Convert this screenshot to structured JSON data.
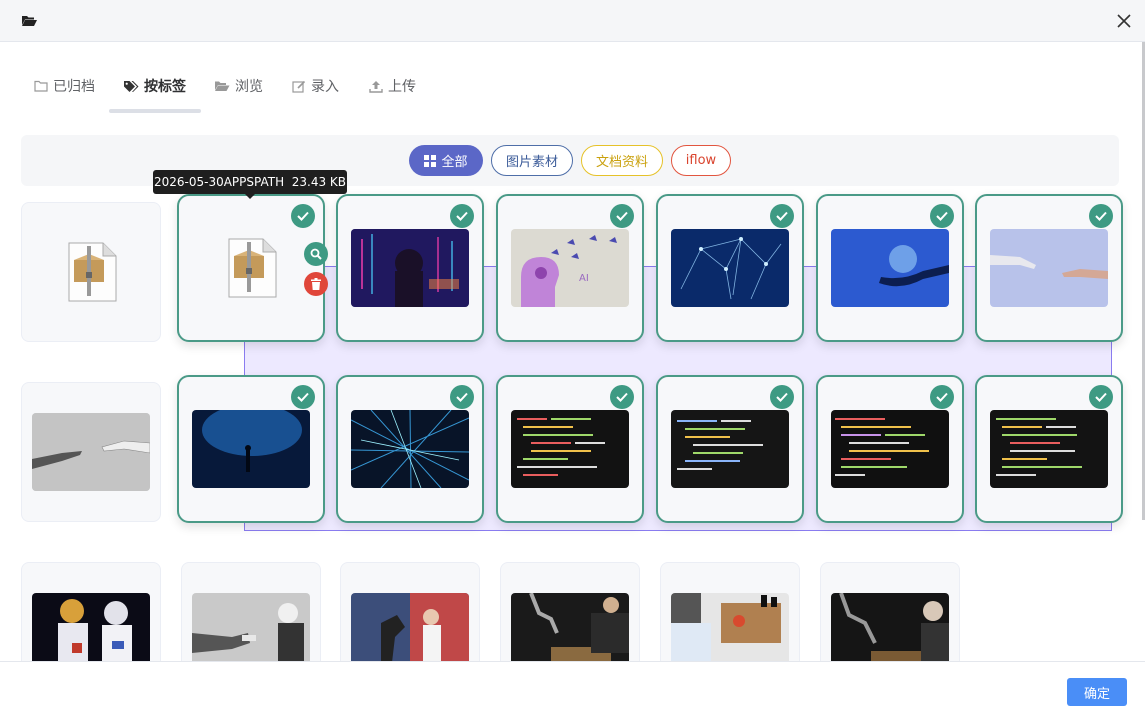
{
  "tabs": [
    {
      "label": "已归档",
      "icon": "folder-outline-icon"
    },
    {
      "label": "按标签",
      "icon": "tags-icon"
    },
    {
      "label": "浏览",
      "icon": "folder-open-icon"
    },
    {
      "label": "录入",
      "icon": "edit-icon"
    },
    {
      "label": "上传",
      "icon": "upload-icon"
    }
  ],
  "active_tab": "按标签",
  "filters": [
    {
      "label": "全部",
      "active": true,
      "color": "#5b67c7"
    },
    {
      "label": "图片素材",
      "color": "#3b5b99"
    },
    {
      "label": "文档资料",
      "color": "#caa10d"
    },
    {
      "label": "iflow",
      "color": "#d9442e"
    }
  ],
  "tooltip": {
    "text": "2026-05-30APPSPATH  23.43 KB"
  },
  "footer": {
    "confirm_label": "确定"
  },
  "colors": {
    "selected_border": "#4a9a87",
    "check": "#3e9a83",
    "delete": "#e0463a",
    "primary": "#4a8ef7"
  },
  "files": [
    {
      "kind": "zip",
      "selected": false,
      "desc": "zip archive"
    },
    {
      "kind": "zip",
      "selected": true,
      "desc": "zip archive (hovered)"
    },
    {
      "kind": "image",
      "selected": true,
      "desc": "woman with digital data overlay"
    },
    {
      "kind": "image",
      "selected": true,
      "desc": "AI head with butterflies"
    },
    {
      "kind": "image",
      "selected": true,
      "desc": "blue neural network figure"
    },
    {
      "kind": "image",
      "selected": true,
      "desc": "hand holding blue sphere"
    },
    {
      "kind": "image",
      "selected": true,
      "desc": "robot hand reaching human hand"
    },
    {
      "kind": "image",
      "selected": false,
      "desc": "grayscale hands reaching"
    },
    {
      "kind": "image",
      "selected": true,
      "desc": "person under blue light"
    },
    {
      "kind": "image",
      "selected": true,
      "desc": "abstract network lines"
    },
    {
      "kind": "image",
      "selected": true,
      "desc": "code on dark screen"
    },
    {
      "kind": "image",
      "selected": true,
      "desc": "code on dark screen"
    },
    {
      "kind": "image",
      "selected": true,
      "desc": "code on dark screen"
    },
    {
      "kind": "image",
      "selected": true,
      "desc": "code on dark screen"
    },
    {
      "kind": "image",
      "selected": false,
      "desc": "robots in space suits"
    },
    {
      "kind": "image",
      "selected": false,
      "desc": "robot arm and elderly man"
    },
    {
      "kind": "image",
      "selected": false,
      "desc": "woman with robot arm"
    },
    {
      "kind": "image",
      "selected": false,
      "desc": "robot playing chess"
    },
    {
      "kind": "image",
      "selected": false,
      "desc": "chess board with robot"
    },
    {
      "kind": "image",
      "selected": false,
      "desc": "elderly man and robot chess"
    }
  ]
}
